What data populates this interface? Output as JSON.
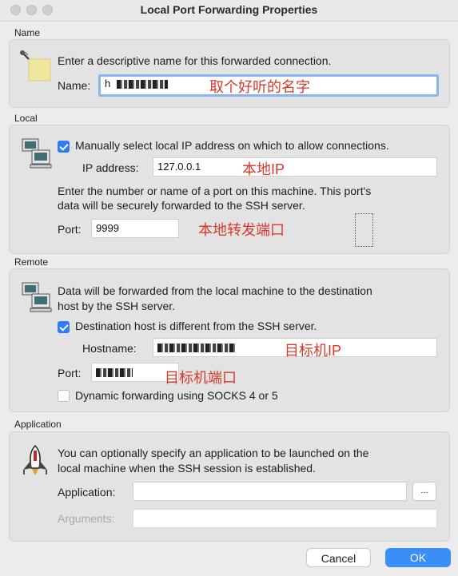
{
  "window": {
    "title": "Local Port Forwarding Properties"
  },
  "name_section": {
    "label": "Name",
    "description": "Enter a descriptive name for this forwarded connection.",
    "name_label": "Name:",
    "name_value": "h",
    "annotation": "取个好听的名字"
  },
  "local_section": {
    "label": "Local",
    "manual_ip_label": "Manually select local IP address on which to allow connections.",
    "manual_ip_checked": true,
    "ip_label": "IP address:",
    "ip_value": "127.0.0.1",
    "ip_annotation": "本地IP",
    "port_help_line1": "Enter the number or name of a port on this machine. This port's",
    "port_help_line2": "data will be securely forwarded to the SSH server.",
    "port_label": "Port:",
    "port_value": "9999",
    "port_annotation": "本地转发端口"
  },
  "remote_section": {
    "label": "Remote",
    "description_line1": "Data will be forwarded from the local machine to the destination",
    "description_line2": "host by the SSH server.",
    "dest_diff_label": "Destination host is different from the SSH server.",
    "dest_diff_checked": true,
    "hostname_label": "Hostname:",
    "hostname_annotation": "目标机IP",
    "port_label": "Port:",
    "port_annotation": "目标机端口",
    "dynamic_label": "Dynamic forwarding using SOCKS 4 or 5",
    "dynamic_checked": false
  },
  "application_section": {
    "label": "Application",
    "description_line1": "You can optionally specify an application to be launched on the",
    "description_line2": "local machine when the SSH session is established.",
    "application_label": "Application:",
    "application_value": "",
    "browse_label": "...",
    "arguments_label": "Arguments:",
    "arguments_value": ""
  },
  "buttons": {
    "cancel": "Cancel",
    "ok": "OK"
  },
  "colors": {
    "accent": "#3a8ef6",
    "annotation": "#d8392b",
    "focus_ring": "#8ab6ef"
  },
  "icons": {
    "name": "pin-note-icon",
    "local": "computer-icon",
    "remote": "network-computers-icon",
    "application": "rocket-icon"
  }
}
